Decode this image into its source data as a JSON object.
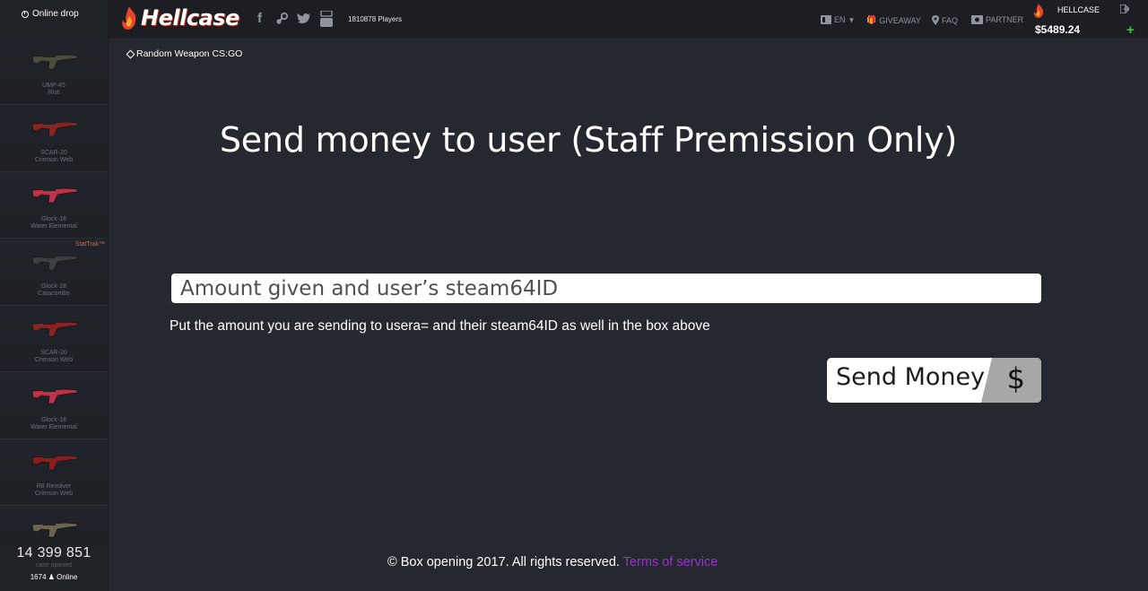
{
  "sidebar": {
    "title": "Online drop",
    "items": [
      {
        "weapon": "UMP-45",
        "skin": "Riot",
        "color": "#4a4f3c",
        "stattrak": ""
      },
      {
        "weapon": "SCAR-20",
        "skin": "Crimson Web",
        "color": "#8a2424",
        "stattrak": ""
      },
      {
        "weapon": "Glock-18",
        "skin": "Water Elemental",
        "color": "#c0324a",
        "stattrak": ""
      },
      {
        "weapon": "Glock-18",
        "skin": "Catacombs",
        "color": "#3b3e42",
        "stattrak": "StatTrak™"
      },
      {
        "weapon": "SCAR-20",
        "skin": "Crimson Web",
        "color": "#8a2424",
        "stattrak": ""
      },
      {
        "weapon": "Glock-18",
        "skin": "Water Elemental",
        "color": "#c0324a",
        "stattrak": ""
      },
      {
        "weapon": "R8 Revolver",
        "skin": "Crimson Web",
        "color": "#8a1e1e",
        "stattrak": ""
      },
      {
        "weapon": "",
        "skin": "",
        "color": "#6b6450",
        "stattrak": ""
      }
    ],
    "cases_opened": "14 399 851",
    "cases_opened_label": "case opened",
    "online_count": "1674",
    "online_label": "Online"
  },
  "header": {
    "logo_text": "Hellcase",
    "players": "1810878 Players",
    "language": "EN",
    "nav": {
      "giveaway": "GIVEAWAY",
      "faq": "FAQ",
      "partner": "PARTNER"
    },
    "username": "HELLCASE",
    "balance": "$5489.24"
  },
  "breadcrumb": "Random Weapon CS:GO",
  "main": {
    "title": "Send money to user (Staff Premission Only)",
    "input_placeholder": "Amount given and user’s steam64ID",
    "helper_text": "Put the amount you are sending to usera= and their steam64ID as well in the box above",
    "send_button_label": "Send Money",
    "send_button_symbol": "$"
  },
  "footer": {
    "copyright": "© Box opening 2017. All rights reserved.",
    "terms_link": "Terms of service"
  },
  "colors": {
    "background": "#25282e",
    "accent_purple": "#9932cc",
    "plus_green": "#3ec53e"
  }
}
